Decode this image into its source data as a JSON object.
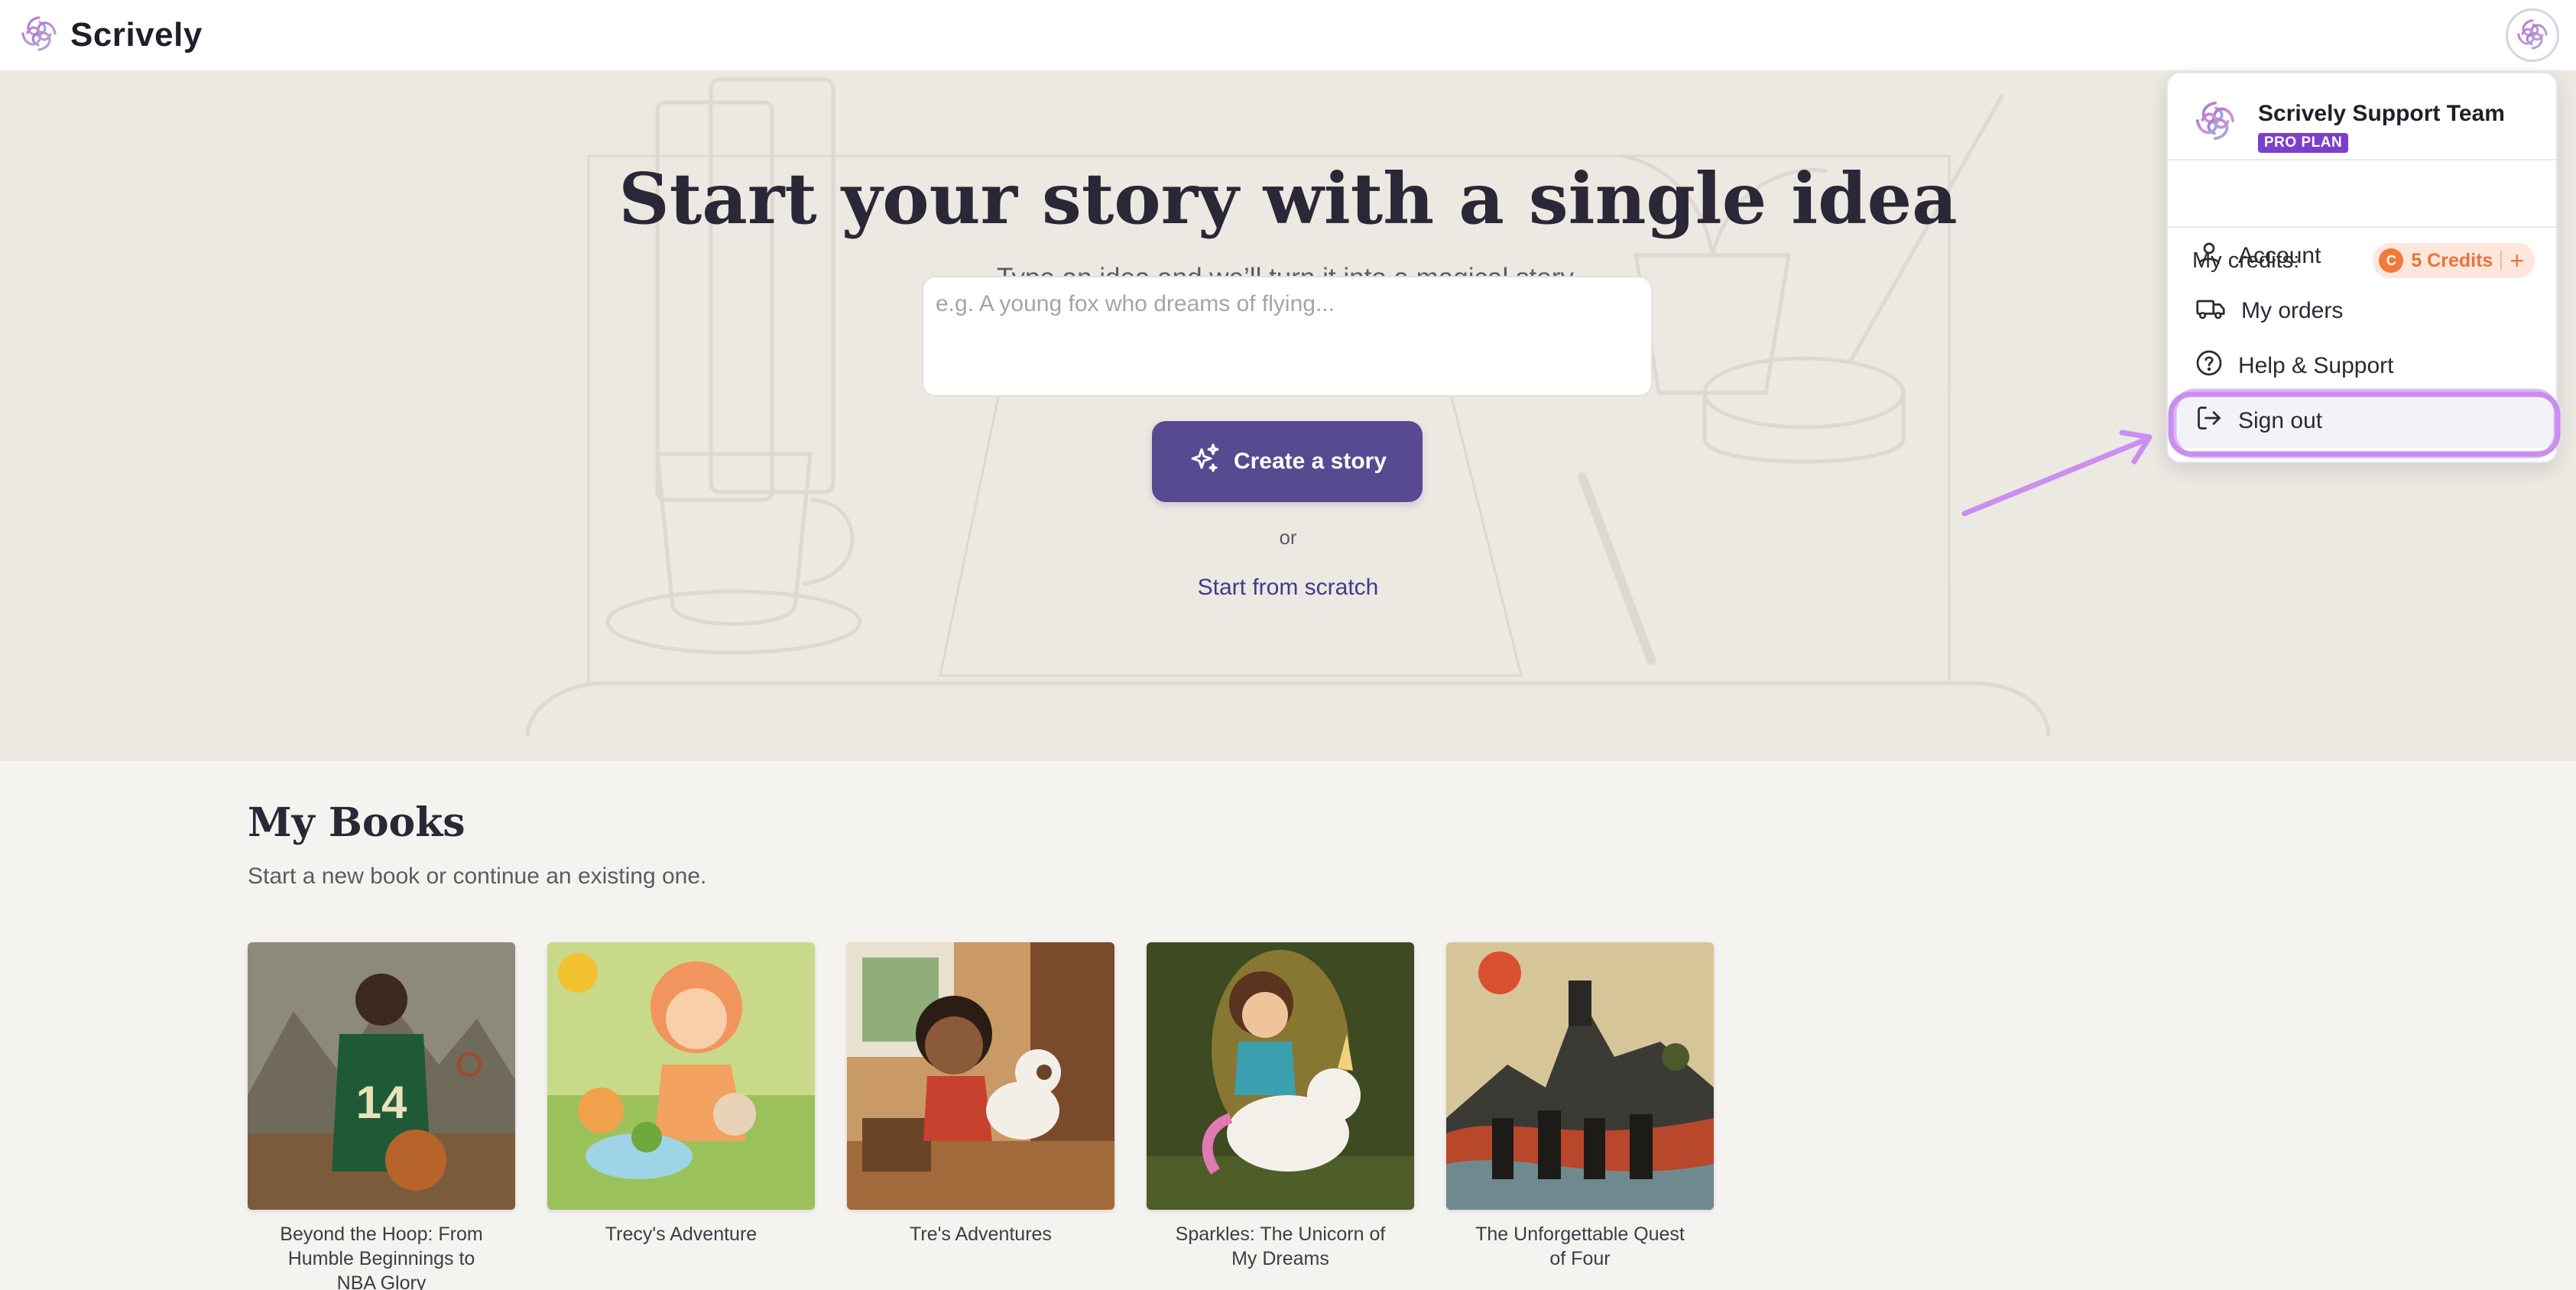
{
  "app": {
    "name": "Scrively"
  },
  "hero": {
    "title": "Start your story with a single idea",
    "subtitle": "Type an idea and we’ll turn it into a magical story.",
    "input_placeholder": "e.g. A young fox who dreams of flying...",
    "input_value": "",
    "create_button": "Create a story",
    "or_text": "or",
    "scratch_link": "Start from scratch"
  },
  "books": {
    "title": "My Books",
    "subtitle": "Start a new book or continue an existing one.",
    "items": [
      {
        "title": "Beyond the Hoop: From Humble Beginnings to NBA Glory"
      },
      {
        "title": "Trecy's Adventure"
      },
      {
        "title": "Tre's Adventures"
      },
      {
        "title": "Sparkles: The Unicorn of My Dreams"
      },
      {
        "title": "The Unforgettable Quest of Four"
      }
    ]
  },
  "menu": {
    "user_name": "Scrively Support Team",
    "plan_badge": "PRO PLAN",
    "credits_label": "My credits:",
    "credits_count": "5 Credits",
    "coin_symbol": "C",
    "plus_symbol": "+",
    "items": [
      {
        "label": "Account",
        "icon": "user-icon"
      },
      {
        "label": "My orders",
        "icon": "truck-icon"
      },
      {
        "label": "Help & Support",
        "icon": "help-circle-icon"
      },
      {
        "label": "Sign out",
        "icon": "sign-out-icon",
        "highlighted": true
      }
    ]
  },
  "colors": {
    "brand_primary": "#574a91",
    "plan_badge": "#7c3fc7",
    "credits_accent": "#e9743a",
    "annotation": "#c98ef0"
  }
}
